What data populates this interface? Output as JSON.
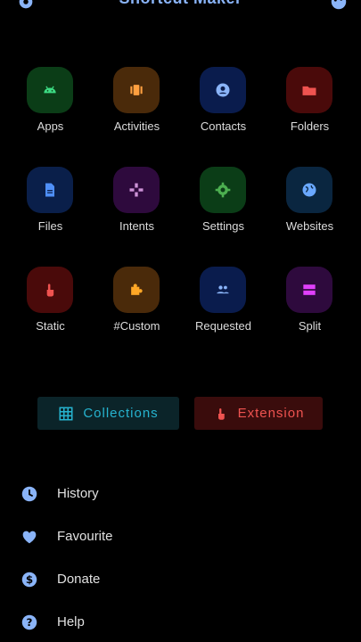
{
  "app": {
    "title": "Shortcut Maker"
  },
  "grid": {
    "tiles": [
      {
        "label": "Apps",
        "icon": "android-icon",
        "bg": "#0b3d17",
        "fg": "#3ddc84"
      },
      {
        "label": "Activities",
        "icon": "activities-icon",
        "bg": "#4a2a0a",
        "fg": "#ffa040"
      },
      {
        "label": "Contacts",
        "icon": "contact-icon",
        "bg": "#0a1c4d",
        "fg": "#8ab4f8"
      },
      {
        "label": "Folders",
        "icon": "folder-icon",
        "bg": "#4a0a0a",
        "fg": "#ef5350"
      },
      {
        "label": "Files",
        "icon": "file-icon",
        "bg": "#0a1f4a",
        "fg": "#4f8ff7"
      },
      {
        "label": "Intents",
        "icon": "gamepad-icon",
        "bg": "#2e0a3d",
        "fg": "#ce93d8"
      },
      {
        "label": "Settings",
        "icon": "gear-icon",
        "bg": "#0b3d17",
        "fg": "#4caf50"
      },
      {
        "label": "Websites",
        "icon": "globe-icon",
        "bg": "#0a2640",
        "fg": "#6aa8ff"
      },
      {
        "label": "Static",
        "icon": "touch-icon",
        "bg": "#4a0a0a",
        "fg": "#ef5350"
      },
      {
        "label": "#Custom",
        "icon": "puzzle-icon",
        "bg": "#4a2a0a",
        "fg": "#ffa726"
      },
      {
        "label": "Requested",
        "icon": "group-icon",
        "bg": "#0a1c4d",
        "fg": "#8ab4f8"
      },
      {
        "label": "Split",
        "icon": "split-icon",
        "bg": "#2e0a3d",
        "fg": "#e040fb"
      }
    ]
  },
  "buttons": {
    "collections": {
      "label": "Collections",
      "icon": "grid-icon",
      "color": "#26b3cf"
    },
    "extension": {
      "label": "Extension",
      "icon": "touch-icon",
      "color": "#ef5350"
    }
  },
  "menu": {
    "items": [
      {
        "label": "History",
        "icon": "clock-icon"
      },
      {
        "label": "Favourite",
        "icon": "heart-icon"
      },
      {
        "label": "Donate",
        "icon": "dollar-icon"
      },
      {
        "label": "Help",
        "icon": "help-icon"
      }
    ],
    "icon_color": "#8ab4f8"
  }
}
